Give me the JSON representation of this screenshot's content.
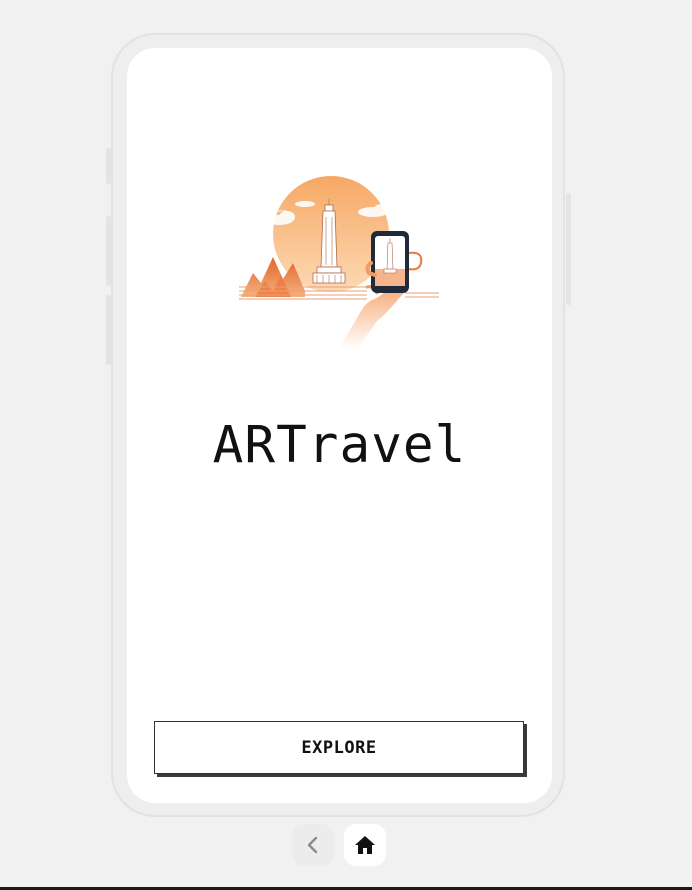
{
  "app": {
    "title": "ARTravel"
  },
  "main": {
    "explore_label": "EXPLORE"
  },
  "nav": {
    "back_icon": "chevron-left-icon",
    "home_icon": "home-icon"
  },
  "colors": {
    "accent": "#f39a5a",
    "accent_light": "#fcd2a8",
    "phone_dark": "#1f2a3a"
  }
}
